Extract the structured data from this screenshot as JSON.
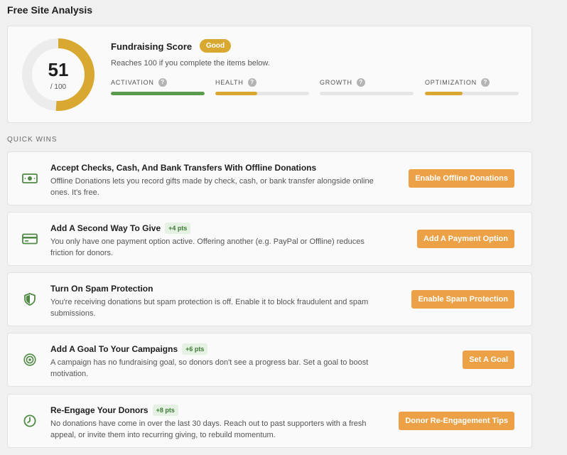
{
  "page": {
    "title": "Free Site Analysis"
  },
  "score": {
    "value": "51",
    "max": "/ 100",
    "percent": 51,
    "title": "Fundraising Score",
    "badge": "Good",
    "subtitle": "Reaches 100 if you complete the items below.",
    "colors": {
      "gauge": "#d9a830",
      "track": "#ececec"
    },
    "metrics": [
      {
        "label": "ACTIVATION",
        "percent": 100,
        "color": "#5b9b4d"
      },
      {
        "label": "HEALTH",
        "percent": 45,
        "color": "#d9a830"
      },
      {
        "label": "GROWTH",
        "percent": 0,
        "color": "#d9a830"
      },
      {
        "label": "OPTIMIZATION",
        "percent": 40,
        "color": "#d9a830"
      }
    ]
  },
  "quick_wins": {
    "heading": "QUICK WINS",
    "items": [
      {
        "icon": "cash-icon",
        "title": "Accept Checks, Cash, And Bank Transfers With Offline Donations",
        "pts": "",
        "description": "Offline Donations lets you record gifts made by check, cash, or bank transfer alongside online ones. It's free.",
        "button": "Enable Offline Donations"
      },
      {
        "icon": "credit-card-icon",
        "title": "Add A Second Way To Give",
        "pts": "+4 pts",
        "description": "You only have one payment option active. Offering another (e.g. PayPal or Offline) reduces friction for donors.",
        "button": "Add A Payment Option"
      },
      {
        "icon": "shield-icon",
        "title": "Turn On Spam Protection",
        "pts": "",
        "description": "You're receiving donations but spam protection is off. Enable it to block fraudulent and spam submissions.",
        "button": "Enable Spam Protection"
      },
      {
        "icon": "target-icon",
        "title": "Add A Goal To Your Campaigns",
        "pts": "+6 pts",
        "description": "A campaign has no fundraising goal, so donors don't see a progress bar. Set a goal to boost motivation.",
        "button": "Set A Goal"
      },
      {
        "icon": "clock-icon",
        "title": "Re-Engage Your Donors",
        "pts": "+8 pts",
        "description": "No donations have come in over the last 30 days. Reach out to past supporters with a fresh appeal, or invite them into recurring giving, to rebuild momentum.",
        "button": "Donor Re-Engagement Tips"
      }
    ]
  },
  "colors": {
    "icon_green": "#4f8a44",
    "button": "#eca146"
  }
}
